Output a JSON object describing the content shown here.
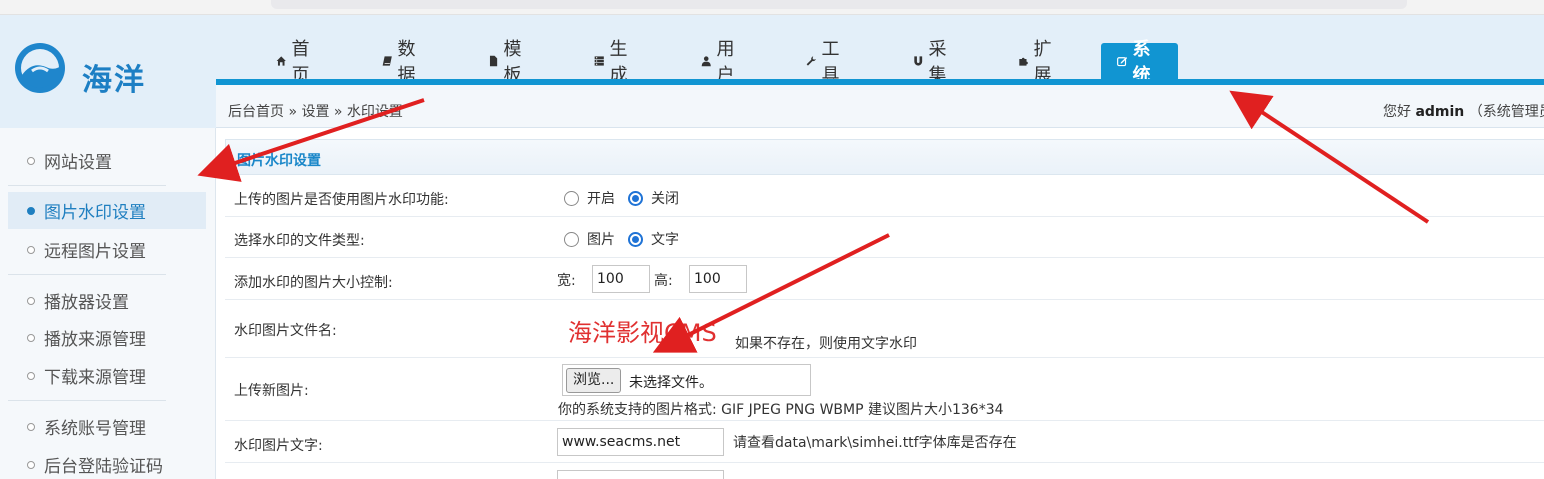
{
  "logo": {
    "text": "海洋"
  },
  "nav": {
    "items": [
      {
        "label": "首页",
        "icon": "home-icon"
      },
      {
        "label": "数据",
        "icon": "book-icon"
      },
      {
        "label": "模板",
        "icon": "file-icon"
      },
      {
        "label": "生成",
        "icon": "server-icon"
      },
      {
        "label": "用户",
        "icon": "user-icon"
      },
      {
        "label": "工具",
        "icon": "wrench-icon"
      },
      {
        "label": "采集",
        "icon": "magnet-icon"
      },
      {
        "label": "扩展",
        "icon": "puzzle-icon"
      },
      {
        "label": "系统",
        "icon": "edit-icon",
        "active": true
      }
    ]
  },
  "breadcrumb": {
    "text": "后台首页 » 设置 » 水印设置"
  },
  "greeting": {
    "prefix": "您好",
    "user": "admin",
    "role": "（系统管理员"
  },
  "sidebar": {
    "items": [
      {
        "label": "网站设置"
      },
      {
        "label": "图片水印设置",
        "active": true
      },
      {
        "label": "远程图片设置"
      },
      {
        "label": "播放器设置"
      },
      {
        "label": "播放来源管理"
      },
      {
        "label": "下载来源管理"
      },
      {
        "label": "系统账号管理"
      },
      {
        "label": "后台登陆验证码"
      }
    ]
  },
  "section": {
    "title": "图片水印设置"
  },
  "form": {
    "enable": {
      "label": "上传的图片是否使用图片水印功能:",
      "on_label": "开启",
      "off_label": "关闭",
      "selected": "关闭"
    },
    "type": {
      "label": "选择水印的文件类型:",
      "image_label": "图片",
      "text_label": "文字",
      "selected": "文字"
    },
    "size": {
      "label": "添加水印的图片大小控制:",
      "width_label": "宽:",
      "width_value": "100",
      "height_label": "高:",
      "height_value": "100"
    },
    "filename": {
      "label": "水印图片文件名:",
      "preview_text": "海洋影视CMS",
      "note": "如果不存在，则使用文字水印"
    },
    "upload": {
      "label": "上传新图片:",
      "button_label": "浏览...",
      "status": "未选择文件。",
      "hint": "你的系统支持的图片格式: GIF JPEG PNG WBMP 建议图片大小136*34"
    },
    "wm_text": {
      "label": "水印图片文字:",
      "value": "www.seacms.net",
      "note": "请查看data\\mark\\simhei.ttf字体库是否存在"
    }
  },
  "colors": {
    "accent": "#1195d2",
    "annotation": "#e02020",
    "watermark_preview": "#e03030"
  }
}
